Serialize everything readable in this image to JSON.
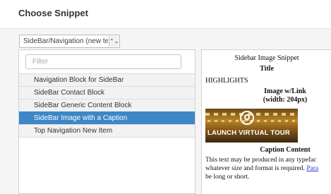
{
  "dialog": {
    "title": "Choose Snippet"
  },
  "snippet_select": {
    "selected": "SideBar/Navigation (new temp",
    "arrow": "⌃⌄"
  },
  "filter": {
    "placeholder": "Filter",
    "value": ""
  },
  "snippets": {
    "items": [
      {
        "label": "Navigation Block for SideBar",
        "selected": false
      },
      {
        "label": "SideBar Contact Block",
        "selected": false
      },
      {
        "label": "SideBar Generic Content Block",
        "selected": false
      },
      {
        "label": "SideBar Image with a Caption",
        "selected": true
      },
      {
        "label": "Top Navigation New Item",
        "selected": false
      }
    ]
  },
  "preview": {
    "heading": "Sidebar Image Snippet",
    "title": "Title",
    "highlights": "HIGHLIGHTS",
    "image_label_1": "Image w/Link",
    "image_label_2": "(width: 204px)",
    "image_text": "LAUNCH VIRTUAL TOUR",
    "caption": "Caption Content",
    "para_line1": "This text may be produced in any typefac",
    "para_line2_text": "whatever size and format is required. ",
    "para_line2_link": "Para",
    "para_line3": "be long or short."
  },
  "colors": {
    "selection": "#3d87c6",
    "link": "#2a3bd8"
  }
}
